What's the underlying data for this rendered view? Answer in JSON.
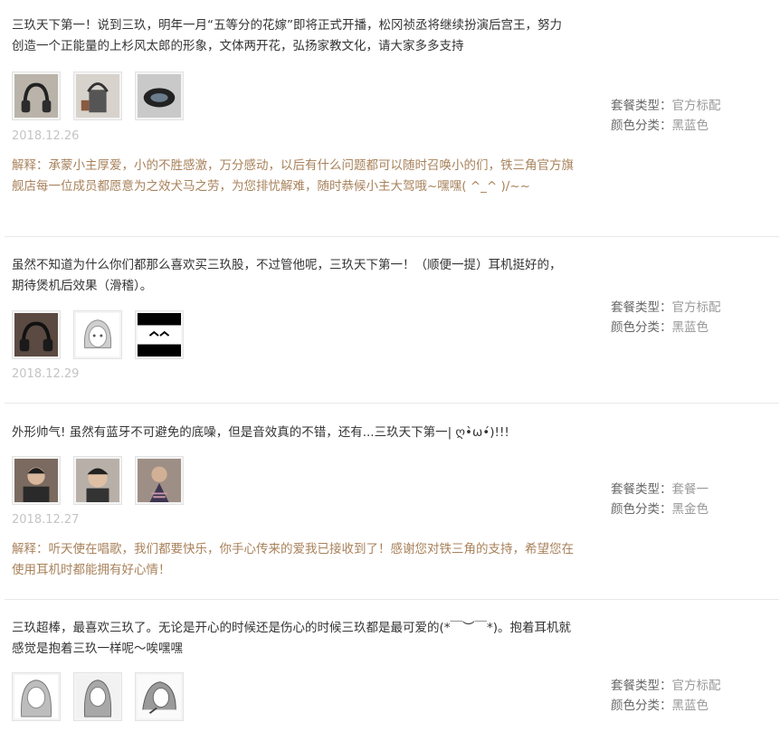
{
  "reviews": [
    {
      "content": "三玖天下第一！说到三玖，明年一月“五等分的花嫁”即将正式开播，松冈祯丞将继续扮演后宫王，努力创造一个正能量的上杉风太郎的形象，文体两开花，弘扬家教文化，请大家多多支持",
      "images": [
        "headphones-photo",
        "headphones-photo",
        "headphones-photo"
      ],
      "date": "2018.12.26",
      "reply": "解释：承蒙小主厚爱，小的不胜感激，万分感动，以后有什么问题都可以随时召唤小的们，铁三角官方旗舰店每一位成员都愿意为之效犬马之劳，为您排忧解难，随时恭候小主大驾哦~嘿嘿( ^_^ )/~~",
      "package_label": "套餐类型：",
      "package_value": "官方标配",
      "color_label": "颜色分类：",
      "color_value": "黑蓝色"
    },
    {
      "content": "虽然不知道为什么你们都那么喜欢买三玖股，不过管他呢，三玖天下第一！（顺便一提）耳机挺好的，期待煲机后效果（滑稽）。",
      "images": [
        "headphones-photo",
        "anime-avatar",
        "anime-screenshot"
      ],
      "date": "2018.12.29",
      "reply": "",
      "package_label": "套餐类型：",
      "package_value": "官方标配",
      "color_label": "颜色分类：",
      "color_value": "黑蓝色"
    },
    {
      "content": "外形帅气! 虽然有蓝牙不可避免的底噪，但是音效真的不错，还有...三玖天下第一| ღ•̀ω•́)!!!",
      "images": [
        "user-photo",
        "user-photo",
        "user-photo"
      ],
      "date": "2018.12.27",
      "reply": "解释：听天使在唱歌，我们都要快乐，你手心传来的爱我已接收到了！感谢您对铁三角的支持，希望您在使用耳机时都能拥有好心情！",
      "package_label": "套餐类型：",
      "package_value": "套餐一",
      "color_label": "颜色分类：",
      "color_value": "黑金色"
    },
    {
      "content": "三玖超棒，最喜欢三玖了。无论是开心的时候还是伤心的时候三玖都是最可爱的(*￣︶￣*)。抱着耳机就感觉是抱着三玖一样呢～唉嘿嘿",
      "images": [
        "anime-avatar",
        "anime-avatar",
        "anime-avatar"
      ],
      "date": "",
      "reply": "",
      "package_label": "套餐类型：",
      "package_value": "官方标配",
      "color_label": "颜色分类：",
      "color_value": "黑蓝色"
    }
  ]
}
